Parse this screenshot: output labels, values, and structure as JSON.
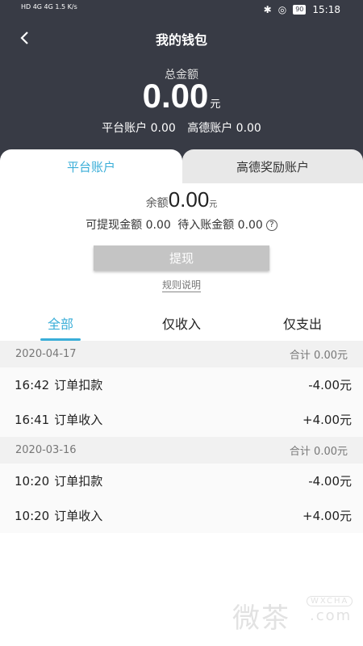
{
  "status_bar": {
    "left_text": "HD 4G 4G 1.5 K/s",
    "battery": "90",
    "time": "15:18"
  },
  "nav": {
    "title": "我的钱包"
  },
  "total": {
    "label": "总金额",
    "amount": "0.00",
    "unit": "元",
    "platform": "平台账户 0.00",
    "gaode": "高德账户 0.00"
  },
  "account_tabs": [
    "平台账户",
    "高德奖励账户"
  ],
  "balance": {
    "label": "余额",
    "amount": "0.00",
    "unit": "元",
    "withdrawable": "可提现金额 0.00",
    "pending": "待入账金额 0.00",
    "help": "?"
  },
  "withdraw_label": "提现",
  "rules_label": "规则说明",
  "filter_tabs": [
    "全部",
    "仅收入",
    "仅支出"
  ],
  "groups": [
    {
      "date": "2020-04-17",
      "sum": "合计 0.00元",
      "items": [
        {
          "time": "16:42",
          "desc": "订单扣款",
          "amount": "-4.00元"
        },
        {
          "time": "16:41",
          "desc": "订单收入",
          "amount": "+4.00元"
        }
      ]
    },
    {
      "date": "2020-03-16",
      "sum": "合计 0.00元",
      "items": [
        {
          "time": "10:20",
          "desc": "订单扣款",
          "amount": "-4.00元"
        },
        {
          "time": "10:20",
          "desc": "订单收入",
          "amount": "+4.00元"
        }
      ]
    }
  ],
  "watermark": {
    "main": "微茶",
    "badge": "WXCHA",
    "com": ".com"
  },
  "colors": {
    "header_bg": "#383b45",
    "accent": "#3aaed8",
    "button": "#c4c4c4"
  }
}
